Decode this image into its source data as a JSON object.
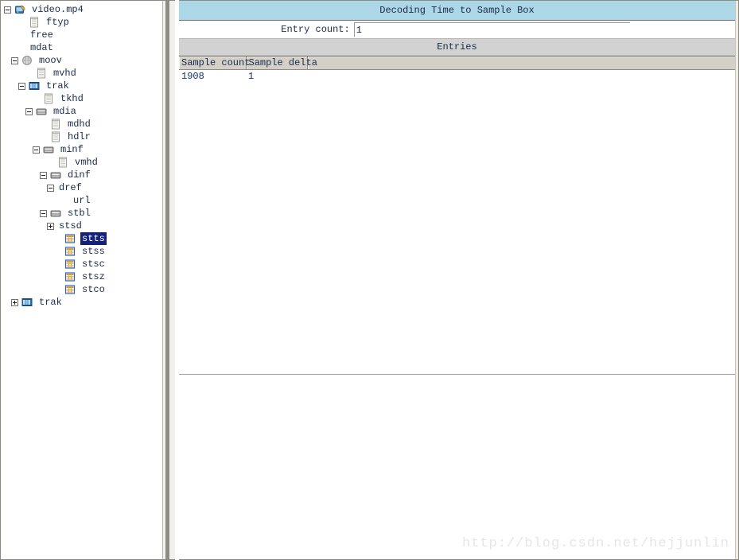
{
  "tree": {
    "name": "mp4-box-tree",
    "nodes": [
      {
        "label": "video.mp4",
        "depth": 0,
        "toggle": "minus",
        "icon": "video-file-icon",
        "selected": false
      },
      {
        "label": "ftyp",
        "depth": 2,
        "toggle": "none",
        "icon": "document-icon",
        "selected": false
      },
      {
        "label": "free",
        "depth": 2,
        "toggle": "none",
        "icon": "none",
        "selected": false
      },
      {
        "label": "mdat",
        "depth": 2,
        "toggle": "none",
        "icon": "none",
        "selected": false
      },
      {
        "label": "moov",
        "depth": 1,
        "toggle": "minus",
        "icon": "globe-icon",
        "selected": false
      },
      {
        "label": "mvhd",
        "depth": 3,
        "toggle": "none",
        "icon": "document-icon",
        "selected": false
      },
      {
        "label": "trak",
        "depth": 2,
        "toggle": "minus",
        "icon": "film-strip-icon",
        "selected": false
      },
      {
        "label": "tkhd",
        "depth": 4,
        "toggle": "none",
        "icon": "document-icon",
        "selected": false
      },
      {
        "label": "mdia",
        "depth": 3,
        "toggle": "minus",
        "icon": "container-icon",
        "selected": false
      },
      {
        "label": "mdhd",
        "depth": 5,
        "toggle": "none",
        "icon": "document-icon",
        "selected": false
      },
      {
        "label": "hdlr",
        "depth": 5,
        "toggle": "none",
        "icon": "document-icon",
        "selected": false
      },
      {
        "label": "minf",
        "depth": 4,
        "toggle": "minus",
        "icon": "container-icon",
        "selected": false
      },
      {
        "label": "vmhd",
        "depth": 6,
        "toggle": "none",
        "icon": "document-icon",
        "selected": false
      },
      {
        "label": "dinf",
        "depth": 5,
        "toggle": "minus",
        "icon": "container-icon",
        "selected": false
      },
      {
        "label": "dref",
        "depth": 6,
        "toggle": "minus",
        "icon": "none",
        "selected": false
      },
      {
        "label": "url",
        "depth": 8,
        "toggle": "none",
        "icon": "none",
        "selected": false
      },
      {
        "label": "stbl",
        "depth": 5,
        "toggle": "minus",
        "icon": "container-icon",
        "selected": false
      },
      {
        "label": "stsd",
        "depth": 6,
        "toggle": "plus",
        "icon": "none",
        "selected": false
      },
      {
        "label": "stts",
        "depth": 7,
        "toggle": "none",
        "icon": "table-icon",
        "selected": true
      },
      {
        "label": "stss",
        "depth": 7,
        "toggle": "none",
        "icon": "table-icon",
        "selected": false
      },
      {
        "label": "stsc",
        "depth": 7,
        "toggle": "none",
        "icon": "table-icon",
        "selected": false
      },
      {
        "label": "stsz",
        "depth": 7,
        "toggle": "none",
        "icon": "table-icon",
        "selected": false
      },
      {
        "label": "stco",
        "depth": 7,
        "toggle": "none",
        "icon": "table-icon",
        "selected": false
      },
      {
        "label": "trak",
        "depth": 1,
        "toggle": "plus",
        "icon": "film-strip-icon",
        "selected": false
      }
    ]
  },
  "detail": {
    "title": "Decoding Time to Sample Box",
    "entry_count_label": "Entry count:",
    "entry_count_value": "1",
    "entries_band_label": "Entries",
    "table": {
      "columns": [
        "Sample count",
        "Sample delta",
        ""
      ],
      "rows": [
        [
          "1908",
          "1",
          ""
        ]
      ]
    }
  },
  "watermark": "http://blog.csdn.net/hejjunlin",
  "colors": {
    "title_bar": "#abd7e6",
    "entries_band": "#d2d2d2",
    "table_header": "#d4d0c8",
    "selection": "#16217a",
    "text": "#1b2a4a"
  }
}
